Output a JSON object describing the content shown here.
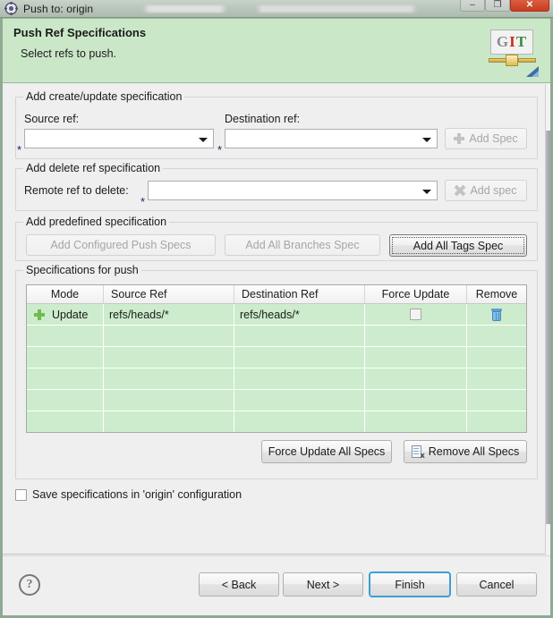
{
  "window": {
    "title": "Push to: origin",
    "icon": "git-repo-icon",
    "controls": {
      "minimize": "–",
      "maximize": "❐",
      "close": "✕"
    }
  },
  "banner": {
    "title": "Push Ref Specifications",
    "subtitle": "Select refs to push.",
    "logo": {
      "g": "G",
      "i": "I",
      "t": "T"
    },
    "accent_green": "#cae8c8"
  },
  "create_update_group": {
    "label": "Add create/update specification",
    "source_label": "Source ref:",
    "destination_label": "Destination ref:",
    "source_value": "",
    "destination_value": "",
    "required_marker": "*",
    "add_spec_button": "Add Spec"
  },
  "delete_group": {
    "label": "Add delete ref specification",
    "remote_label": "Remote ref to delete:",
    "remote_value": "",
    "required_marker": "*",
    "add_spec_button": "Add spec"
  },
  "predefined_group": {
    "label": "Add predefined specification",
    "buttons": [
      {
        "label": "Add Configured Push Specs",
        "enabled": false,
        "focused": false
      },
      {
        "label": "Add All Branches Spec",
        "enabled": false,
        "focused": false
      },
      {
        "label": "Add All Tags Spec",
        "enabled": true,
        "focused": true
      }
    ]
  },
  "specs_group": {
    "label": "Specifications for push",
    "columns": [
      "Mode",
      "Source Ref",
      "Destination Ref",
      "Force Update",
      "Remove"
    ],
    "rows": [
      {
        "mode_icon": "plus-icon",
        "mode": "Update",
        "source_ref": "refs/heads/*",
        "destination_ref": "refs/heads/*",
        "force_update": false,
        "remove_icon": "trash-icon"
      }
    ],
    "empty_row_count": 5,
    "row_color": "#cdeccd",
    "force_update_all_button": "Force Update All Specs",
    "remove_all_button": "Remove All Specs"
  },
  "save_option": {
    "label": "Save specifications in 'origin' configuration",
    "checked": false
  },
  "footer": {
    "help": "?",
    "buttons": [
      {
        "label": "< Back",
        "default": false
      },
      {
        "label": "Next >",
        "default": false
      },
      {
        "label": "Finish",
        "default": true
      },
      {
        "label": "Cancel",
        "default": false
      }
    ],
    "default_accent": "#3c9fd4"
  }
}
